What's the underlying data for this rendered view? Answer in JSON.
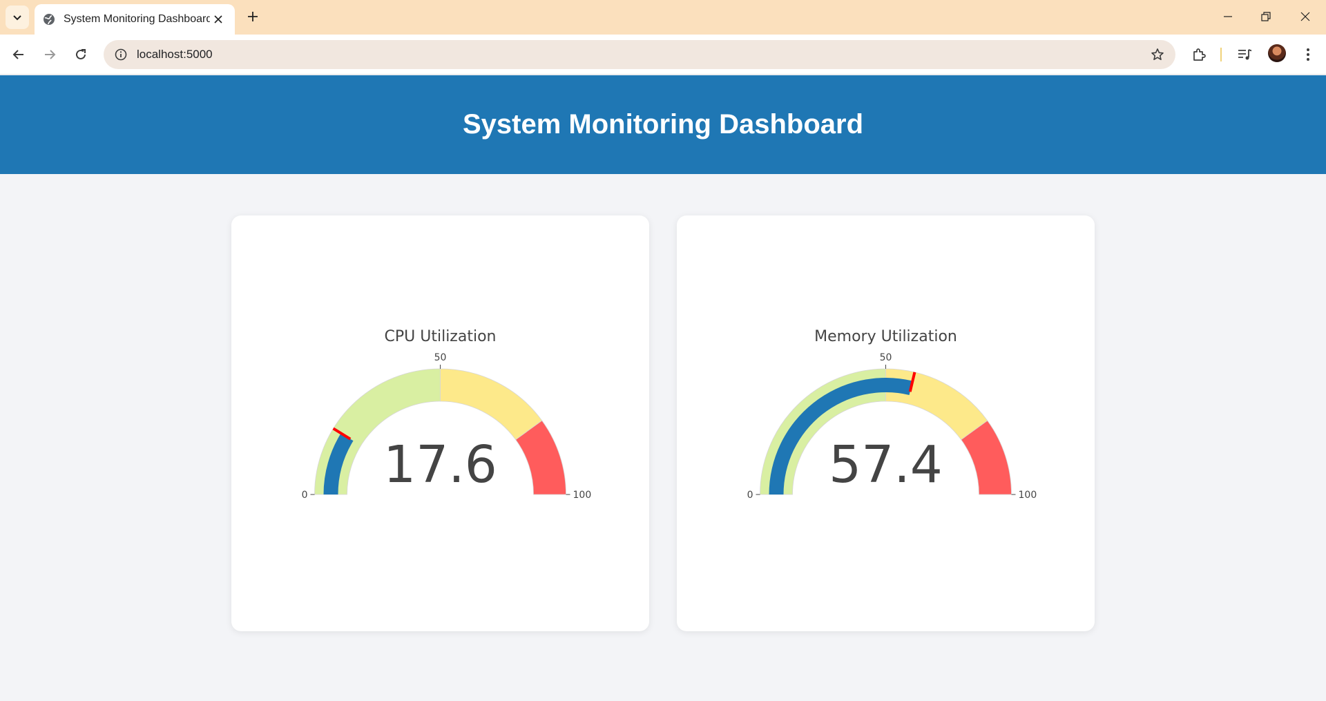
{
  "browser": {
    "tab_title": "System Monitoring Dashboard",
    "url": "localhost:5000",
    "icons": [
      "tab-search-icon",
      "globe-icon",
      "close-icon",
      "plus-icon",
      "minimize-icon",
      "restore-icon",
      "back-icon",
      "forward-icon",
      "reload-icon",
      "info-icon",
      "star-icon",
      "extensions-icon",
      "media-icon",
      "menu-icon"
    ]
  },
  "header": {
    "title": "System Monitoring Dashboard"
  },
  "colors": {
    "header_bg": "#1f77b4",
    "bar": "#1f77b4",
    "step_low": "#d9efa2",
    "step_mid": "#fde98a",
    "step_high": "#ff5c5c",
    "threshold": "#ff0000"
  },
  "chart_data": [
    {
      "type": "gauge",
      "title": "CPU Utilization",
      "value": 17.6,
      "value_label": "17.6",
      "range": [
        0,
        100
      ],
      "tick_labels": {
        "min": "0",
        "mid": "50",
        "max": "100"
      },
      "steps": [
        {
          "range": [
            0,
            50
          ],
          "color": "#d9efa2"
        },
        {
          "range": [
            50,
            80
          ],
          "color": "#fde98a"
        },
        {
          "range": [
            80,
            100
          ],
          "color": "#ff5c5c"
        }
      ],
      "threshold": 17.6
    },
    {
      "type": "gauge",
      "title": "Memory Utilization",
      "value": 57.4,
      "value_label": "57.4",
      "range": [
        0,
        100
      ],
      "tick_labels": {
        "min": "0",
        "mid": "50",
        "max": "100"
      },
      "steps": [
        {
          "range": [
            0,
            50
          ],
          "color": "#d9efa2"
        },
        {
          "range": [
            50,
            80
          ],
          "color": "#fde98a"
        },
        {
          "range": [
            80,
            100
          ],
          "color": "#ff5c5c"
        }
      ],
      "threshold": 57.4
    }
  ]
}
